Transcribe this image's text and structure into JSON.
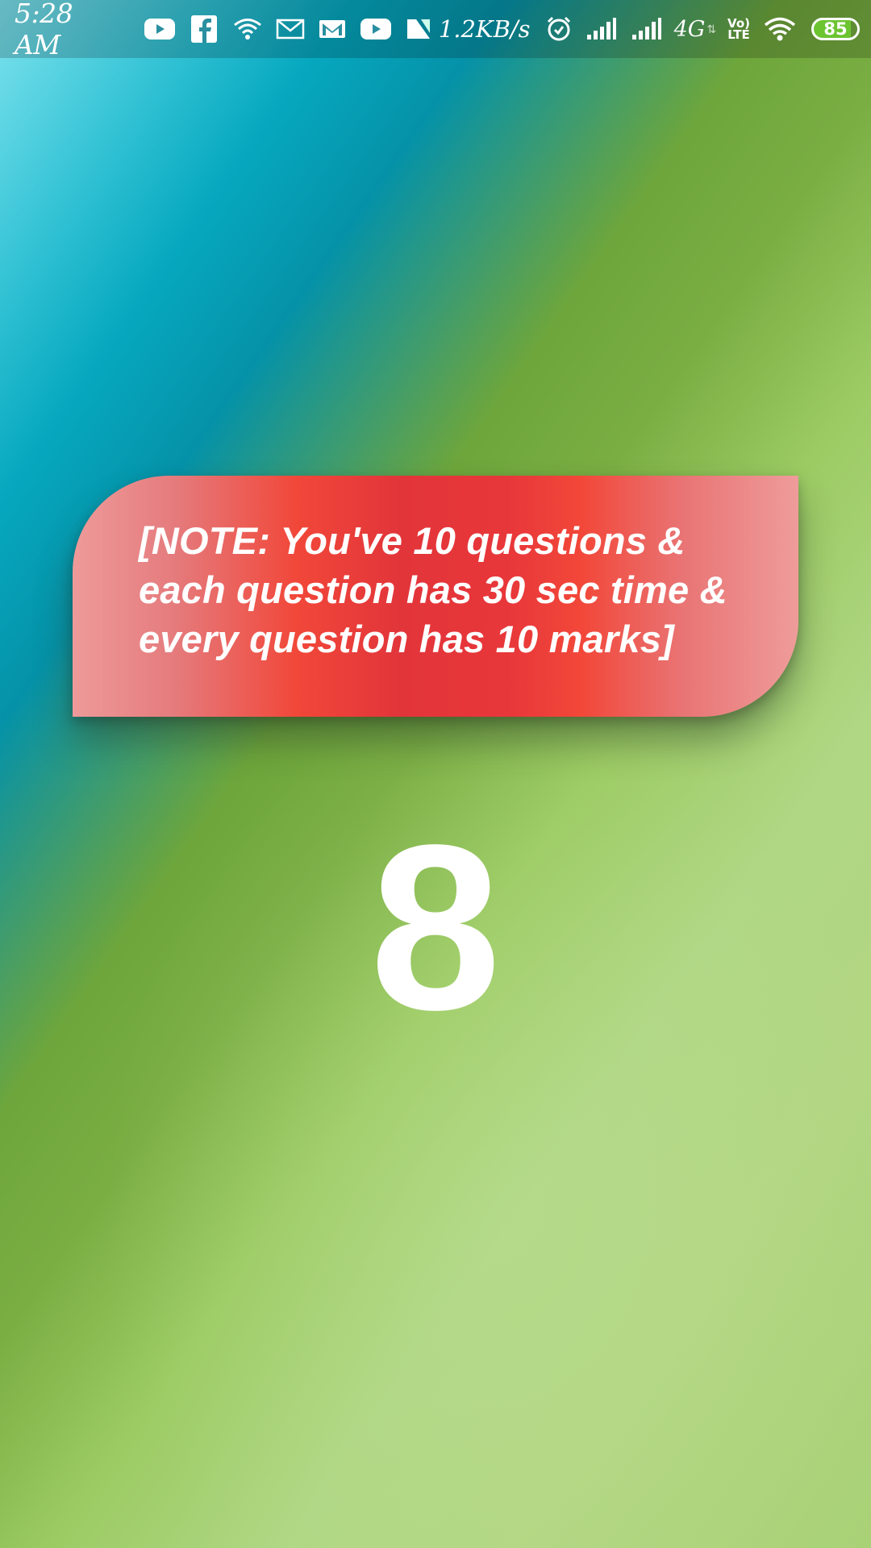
{
  "status_bar": {
    "time": "5:28 AM",
    "net_speed": "1.2KB/s",
    "network_type": "4G",
    "volte_top": "Vo)",
    "volte_bottom": "LTE",
    "battery_level": "85",
    "icons_left": [
      "youtube-icon",
      "facebook-icon",
      "wifi-icon",
      "mail-icon",
      "gmail-icon",
      "youtube-icon",
      "n-app-icon"
    ],
    "icons_right": [
      "alarm-icon",
      "signal-icon",
      "signal-icon",
      "wifi-icon",
      "battery-icon"
    ],
    "battery_color": "#6cc431"
  },
  "note": {
    "text": "[NOTE: You've 10 questions & each question has 30 sec time & every question has 10 marks]",
    "colors": {
      "center": "#f14739",
      "edge": "#ee9a9a"
    }
  },
  "countdown": {
    "value": "8"
  }
}
